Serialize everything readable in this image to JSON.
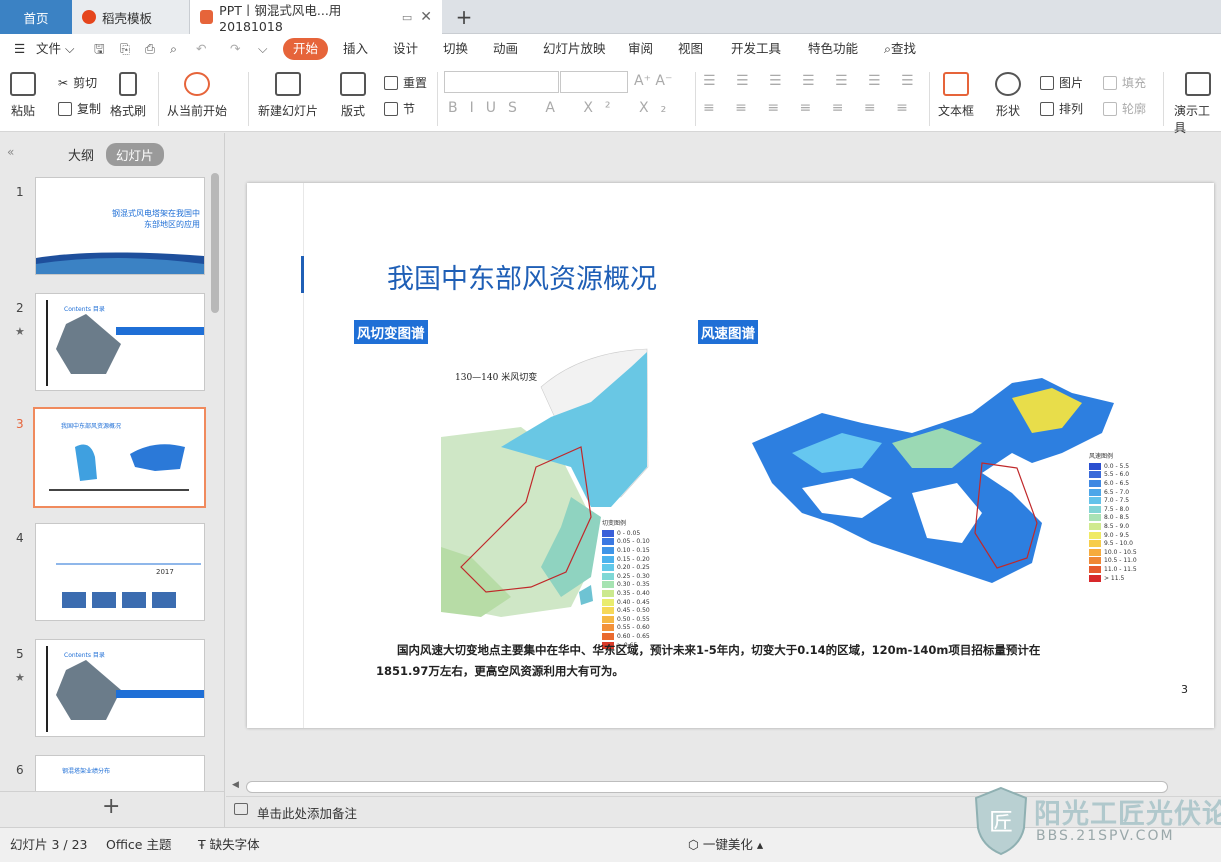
{
  "tabs": {
    "home": "首页",
    "daoke": "稻壳模板",
    "ppt": "PPT丨钢混式风电...用20181018",
    "add": "+"
  },
  "menu": {
    "file": "文件",
    "items": [
      "开始",
      "插入",
      "设计",
      "切换",
      "动画",
      "幻灯片放映",
      "审阅",
      "视图",
      "开发工具",
      "特色功能"
    ],
    "search": "查找"
  },
  "ribbon": {
    "paste": "粘贴",
    "cut": "剪切",
    "copy": "复制",
    "format_brush": "格式刷",
    "from_current": "从当前开始",
    "new_slide": "新建幻灯片",
    "layout": "版式",
    "reset": "重置",
    "section": "节",
    "text_box": "文本框",
    "shape": "形状",
    "picture": "图片",
    "fill": "填充",
    "arrange": "排列",
    "outline": "轮廓",
    "present_tool": "演示工具"
  },
  "left_pane": {
    "outline_tab": "大纲",
    "slides_tab": "幻灯片",
    "collapse": "«",
    "add": "+",
    "thumbs": [
      {
        "num": "1",
        "title": "钢混式风电塔架在我国中东部地区的应用"
      },
      {
        "num": "2",
        "title": "Contents 目录"
      },
      {
        "num": "3",
        "title": "我国中东部风资源概况"
      },
      {
        "num": "4",
        "title": "2017"
      },
      {
        "num": "5",
        "title": "Contents 目录"
      },
      {
        "num": "6",
        "title": "钢混塔架业绩分布"
      }
    ]
  },
  "slide": {
    "title": "我国中东部风资源概况",
    "label_left": "风切变图谱",
    "label_right": "风速图谱",
    "map_left_title": "130—140 米风切变",
    "legend_left_title": "切变图例",
    "legend_right_title": "风速图例",
    "legend_left": [
      "0 - 0.05",
      "0.05 - 0.10",
      "0.10 - 0.15",
      "0.15 - 0.20",
      "0.20 - 0.25",
      "0.25 - 0.30",
      "0.30 - 0.35",
      "0.35 - 0.40",
      "0.40 - 0.45",
      "0.45 - 0.50",
      "0.50 - 0.55",
      "0.55 - 0.60",
      "0.60 - 0.65",
      "> 0.65"
    ],
    "legend_right": [
      "0.0 - 5.5",
      "5.5 - 6.0",
      "6.0 - 6.5",
      "6.5 - 7.0",
      "7.0 - 7.5",
      "7.5 - 8.0",
      "8.0 - 8.5",
      "8.5 - 9.0",
      "9.0 - 9.5",
      "9.5 - 10.0",
      "10.0 - 10.5",
      "10.5 - 11.0",
      "11.0 - 11.5",
      "> 11.5"
    ],
    "body_line1": "国内风速大切变地点主要集中在华中、华东区域，预计未来1-5年内，切变大于0.14的区域，120m-140m项目招标量预计在",
    "body_line2": "1851.97万左右，更高空风资源利用大有可为。",
    "page_number": "3"
  },
  "notes_placeholder": "单击此处添加备注",
  "status": {
    "slide_count": "幻灯片 3 / 23",
    "theme": "Office 主题",
    "missing_font": "缺失字体",
    "beautify": "一键美化"
  },
  "watermark": {
    "text": "阳光工匠光伏论坛",
    "url": "BBS.21SPV.COM"
  },
  "colors": {
    "accent_orange": "#e6643a",
    "tab_blue": "#3b82c4",
    "title_blue": "#1f5fb6",
    "label_bg": "#1f6fd6"
  }
}
